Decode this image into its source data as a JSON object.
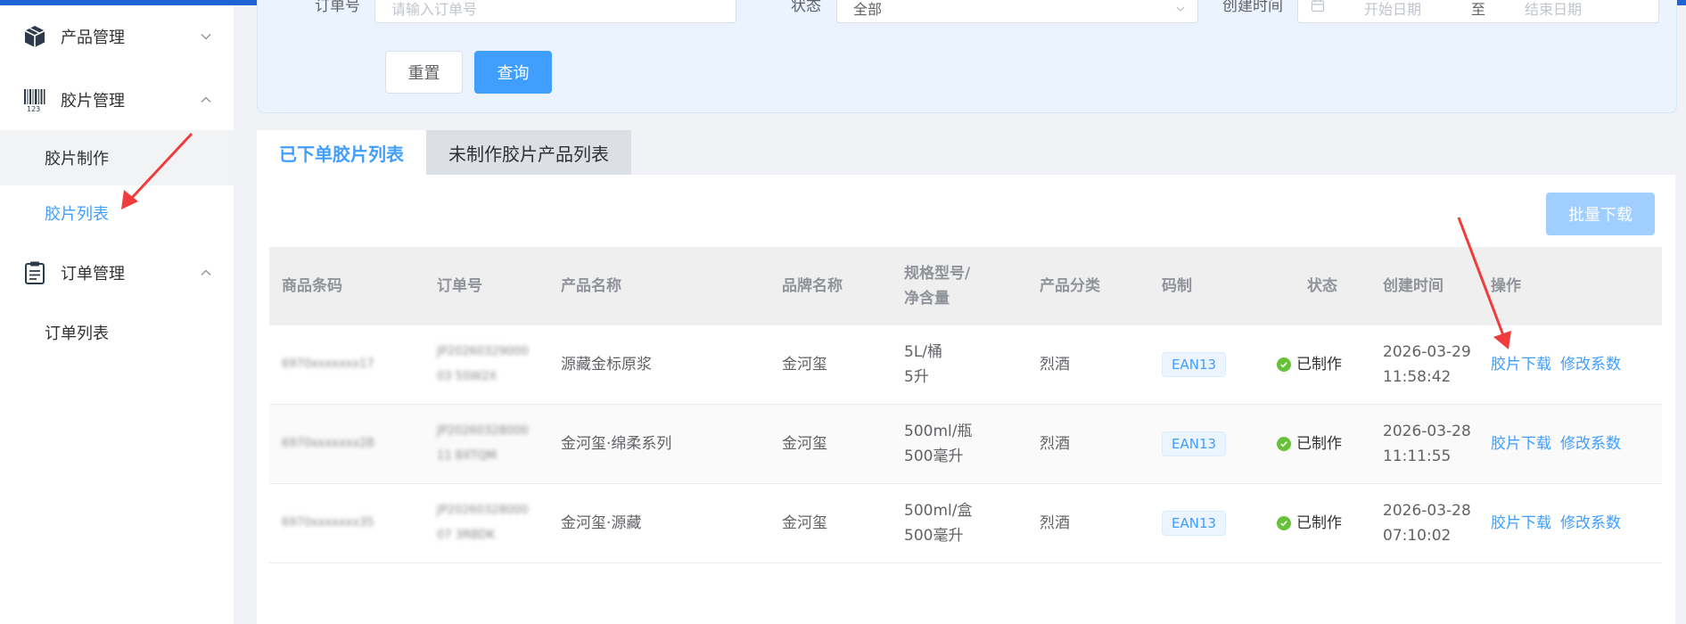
{
  "sidebar": {
    "groups": [
      {
        "label": "产品管理",
        "icon": "cube-icon",
        "expanded": false
      },
      {
        "label": "胶片管理",
        "icon": "barcode-icon",
        "expanded": true
      },
      {
        "label": "订单管理",
        "icon": "clipboard-icon",
        "expanded": true
      }
    ],
    "film_items": [
      {
        "label": "胶片制作"
      },
      {
        "label": "胶片列表",
        "active": true
      }
    ],
    "order_items": [
      {
        "label": "订单列表"
      }
    ]
  },
  "search": {
    "order_label": "订单号",
    "order_placeholder": "请输入订单号",
    "status_label": "状态",
    "status_value": "全部",
    "created_label": "创建时间",
    "start_placeholder": "开始日期",
    "date_separator": "至",
    "end_placeholder": "结束日期",
    "reset_label": "重置",
    "query_label": "查询"
  },
  "tabs": [
    {
      "label": "已下单胶片列表",
      "active": true
    },
    {
      "label": "未制作胶片产品列表",
      "active": false
    }
  ],
  "batch_download_label": "批量下载",
  "table": {
    "headers": [
      "商品条码",
      "订单号",
      "产品名称",
      "品牌名称",
      "规格型号/\n净含量",
      "产品分类",
      "码制",
      "状态",
      "创建时间",
      "操作"
    ],
    "rows": [
      {
        "barcode": "6970xxxxxxx17",
        "order_no": "JP2026032900003 5SW2X",
        "product": "源藏金标原浆",
        "brand": "金河玺",
        "spec": "5L/桶",
        "net": "5升",
        "category": "烈酒",
        "code_type": "EAN13",
        "status": "已制作",
        "date": "2026-03-29",
        "time": "11:58:42",
        "action_download": "胶片下载",
        "action_modify": "修改系数"
      },
      {
        "barcode": "6970xxxxxxx28",
        "order_no": "JP2026032800011 8XTQM",
        "product": "金河玺·绵柔系列",
        "brand": "金河玺",
        "spec": "500ml/瓶",
        "net": "500毫升",
        "category": "烈酒",
        "code_type": "EAN13",
        "status": "已制作",
        "date": "2026-03-28",
        "time": "11:11:55",
        "action_download": "胶片下载",
        "action_modify": "修改系数"
      },
      {
        "barcode": "6970xxxxxxx35",
        "order_no": "JP2026032800007 3RBDK",
        "product": "金河玺·源藏",
        "brand": "金河玺",
        "spec": "500ml/盒",
        "net": "500毫升",
        "category": "烈酒",
        "code_type": "EAN13",
        "status": "已制作",
        "date": "2026-03-28",
        "time": "07:10:02",
        "action_download": "胶片下载",
        "action_modify": "修改系数"
      }
    ]
  },
  "colors": {
    "primary": "#409eff",
    "success": "#67c23a",
    "annotation_arrow": "#f03c3c"
  }
}
